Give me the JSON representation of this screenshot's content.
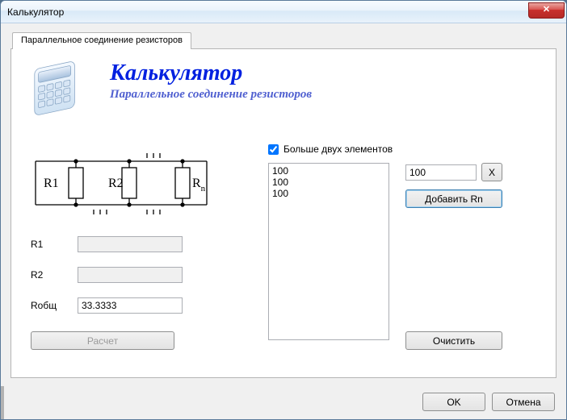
{
  "window": {
    "title": "Калькулятор"
  },
  "tab": {
    "label": "Параллельное соединение резисторов"
  },
  "header": {
    "title": "Калькулятор",
    "subtitle": "Параллельное соединение резисторов"
  },
  "schematic": {
    "r1": "R1",
    "r2": "R2",
    "rn": "R",
    "rn_sub": "n"
  },
  "inputs": {
    "r1": {
      "label": "R1",
      "value": ""
    },
    "r2": {
      "label": "R2",
      "value": ""
    },
    "rtotal": {
      "label": "Rобщ",
      "value": "33.3333"
    }
  },
  "calc_button": "Расчет",
  "checkbox": {
    "label": "Больше двух элементов",
    "checked": true
  },
  "list_items": [
    "100",
    "100",
    "100"
  ],
  "rn_input": "100",
  "x_button": "X",
  "add_rn_button": "Добавить Rn",
  "clear_button": "Очистить",
  "dialog": {
    "ok": "OK",
    "cancel": "Отмена"
  }
}
